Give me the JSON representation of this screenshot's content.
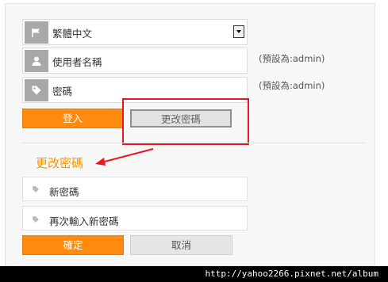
{
  "login": {
    "language": {
      "selected": "繁體中文"
    },
    "username": {
      "placeholder": "使用者名稱",
      "hint": "(預設為:admin)"
    },
    "password": {
      "placeholder": "密碼",
      "hint": "(預設為:admin)"
    },
    "login_label": "登入",
    "change_password_label": "更改密碼"
  },
  "change_password": {
    "heading": "更改密碼",
    "new_password_placeholder": "新密碼",
    "confirm_password_placeholder": "再次輸入新密碼",
    "confirm_label": "確定",
    "cancel_label": "取消"
  },
  "annotation": {
    "color": "#e8191f"
  },
  "colors": {
    "accent": "#ff8a10",
    "heading": "#f39800",
    "panel": "#f7f7f7"
  },
  "watermark": "http://yahoo2266.pixnet.net/album"
}
